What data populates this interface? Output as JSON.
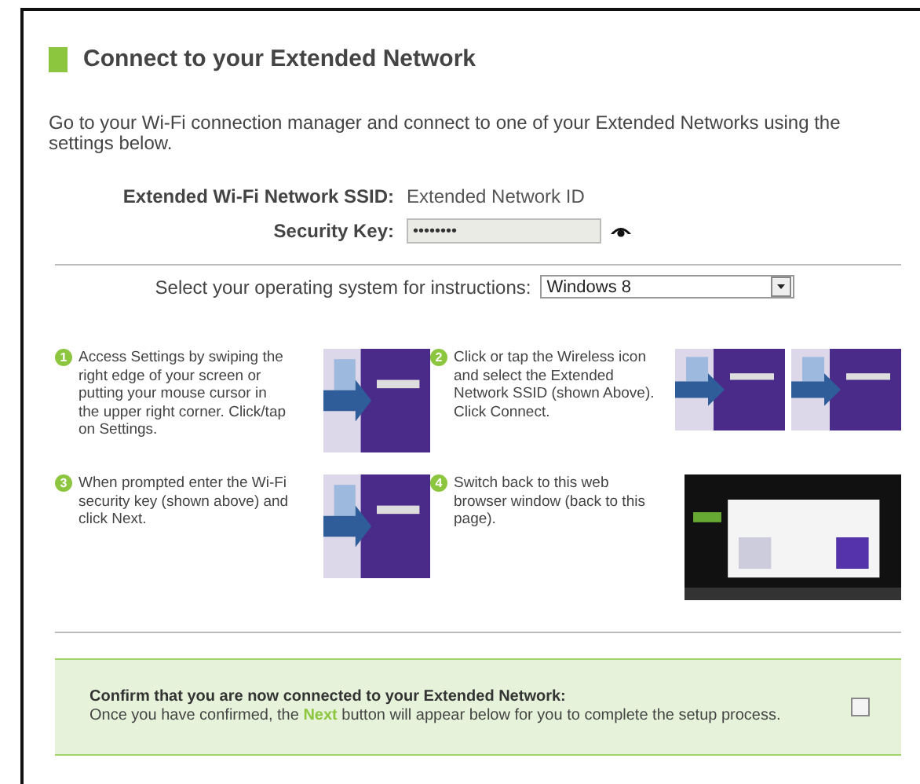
{
  "title": "Connect to your Extended Network",
  "intro": "Go to your Wi-Fi connection manager and connect to one of your Extended Networks using the settings below.",
  "ssid": {
    "label": "Extended Wi-Fi Network SSID:",
    "value": "Extended Network ID"
  },
  "security_key": {
    "label": "Security Key:",
    "value": "••••••••"
  },
  "os_select": {
    "label": "Select your operating system for instructions:",
    "value": "Windows 8"
  },
  "steps": [
    {
      "number": "1",
      "text": "Access Settings by swiping the right edge of your screen or putting your mouse cursor in the upper right corner. Click/tap on Settings."
    },
    {
      "number": "2",
      "text": "Click or tap the Wireless icon and select the Extended Network SSID (shown Above). Click Connect."
    },
    {
      "number": "3",
      "text": "When prompted enter the Wi-Fi security key (shown above) and click Next."
    },
    {
      "number": "4",
      "text": "Switch back to this web browser window (back to this page)."
    }
  ],
  "confirm": {
    "title": "Confirm that you are now connected to your Extended Network:",
    "text": "Once you have confirmed, the **Next** button will appear below for you to complete the setup process.",
    "checked": false
  }
}
